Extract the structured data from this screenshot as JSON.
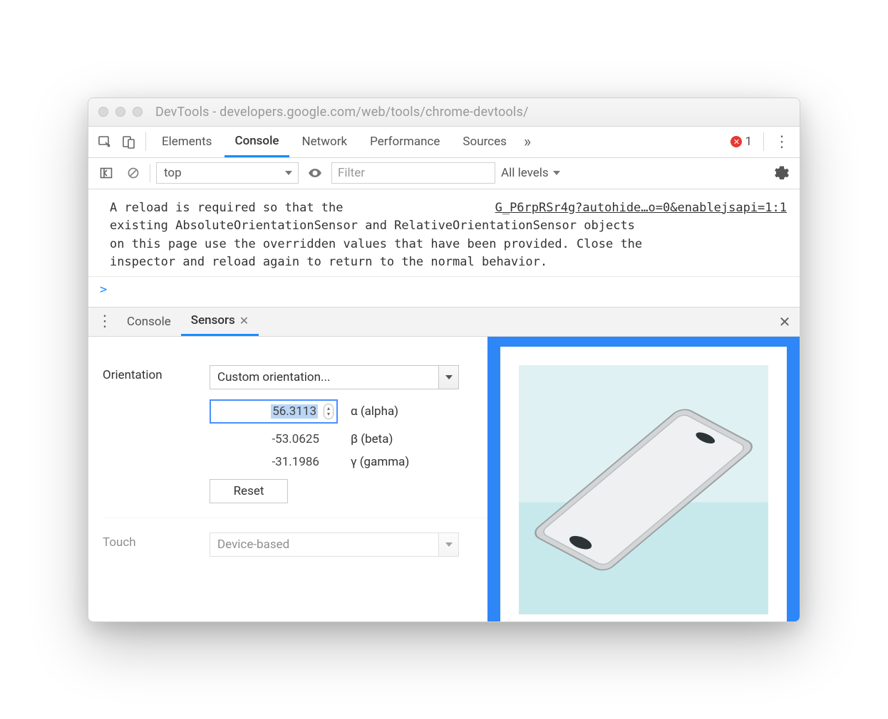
{
  "window": {
    "title": "DevTools - developers.google.com/web/tools/chrome-devtools/"
  },
  "mainTabs": {
    "items": [
      "Elements",
      "Console",
      "Network",
      "Performance",
      "Sources"
    ],
    "activeIndex": 1,
    "overflow": "»",
    "errorCount": "1"
  },
  "consoleBar": {
    "context": "top",
    "filterPlaceholder": "Filter",
    "levels": "All levels"
  },
  "consoleMessage": {
    "link": "G_P6rpRSr4g?autohide…o=0&enablejsapi=1:1",
    "body": "A reload is required so that the\nexisting AbsoluteOrientationSensor and RelativeOrientationSensor objects\non this page use the overridden values that have been provided. Close the\ninspector and reload again to return to the normal behavior."
  },
  "prompt": ">",
  "drawer": {
    "tabs": [
      "Console",
      "Sensors"
    ],
    "activeIndex": 1
  },
  "sensors": {
    "orientation": {
      "label": "Orientation",
      "preset": "Custom orientation...",
      "alpha": {
        "value": "56.3113",
        "label": "α (alpha)"
      },
      "beta": {
        "value": "-53.0625",
        "label": "β (beta)"
      },
      "gamma": {
        "value": "-31.1986",
        "label": "γ (gamma)"
      },
      "reset": "Reset"
    },
    "touch": {
      "label": "Touch",
      "value": "Device-based"
    }
  }
}
